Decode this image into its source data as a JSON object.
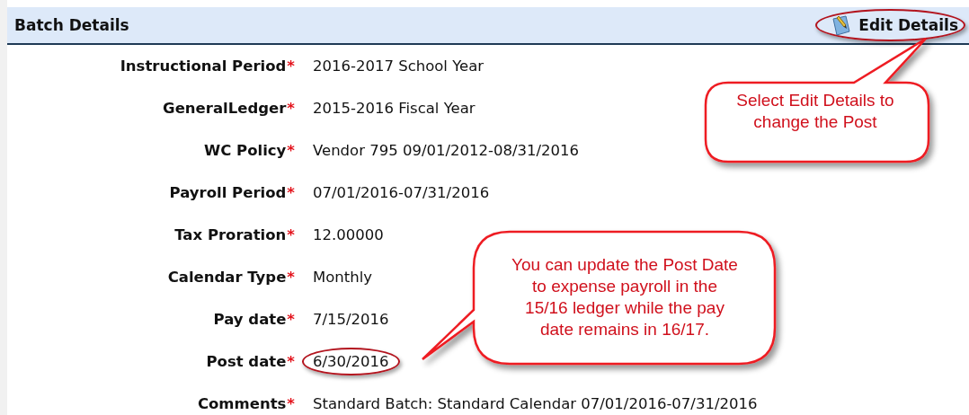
{
  "panel": {
    "title": "Batch Details",
    "edit_button": {
      "label": "Edit Details",
      "highlighted": true
    }
  },
  "fields": [
    {
      "label": "Instructional Period",
      "required_mark": "*",
      "value": "2016-2017 School Year",
      "highlighted": false
    },
    {
      "label": "GeneralLedger",
      "required_mark": "*",
      "value": "2015-2016 Fiscal Year",
      "highlighted": false
    },
    {
      "label": "WC Policy",
      "required_mark": "*",
      "value": "Vendor 795 09/01/2012-08/31/2016",
      "highlighted": false
    },
    {
      "label": "Payroll Period",
      "required_mark": "*",
      "value": "07/01/2016-07/31/2016",
      "highlighted": false
    },
    {
      "label": "Tax Proration",
      "required_mark": "*",
      "value": "12.00000",
      "highlighted": false
    },
    {
      "label": "Calendar Type",
      "required_mark": "*",
      "value": "Monthly",
      "highlighted": false
    },
    {
      "label": "Pay date",
      "required_mark": "*",
      "value": "7/15/2016",
      "highlighted": false
    },
    {
      "label": "Post date",
      "required_mark": "*",
      "value": "6/30/2016",
      "highlighted": true
    },
    {
      "label": "Comments",
      "required_mark": "*",
      "value": "Standard Batch: Standard Calendar 07/01/2016-07/31/2016",
      "highlighted": false
    }
  ],
  "callouts": [
    {
      "kind": "top",
      "text": "Select Edit Details to change the Post"
    },
    {
      "kind": "left",
      "text": "You can update the Post Date to expense payroll in the 15/16 ledger while the pay date remains in 16/17."
    }
  ]
}
